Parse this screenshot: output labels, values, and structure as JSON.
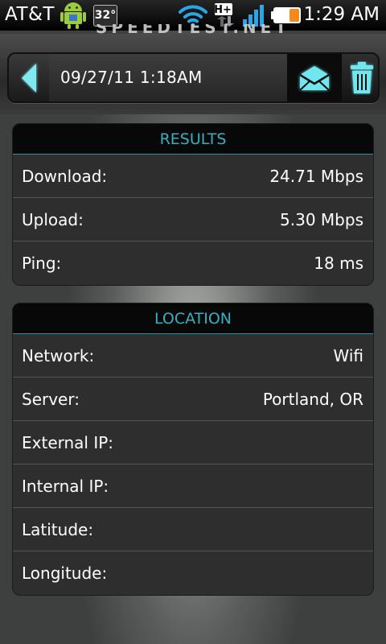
{
  "status_bar": {
    "carrier": "AT&T",
    "temperature": "32°",
    "network_type": "H+",
    "time": "1:29 AM",
    "icons": [
      "android-icon",
      "wifi-icon",
      "hplus-icon",
      "signal-icon",
      "battery-icon"
    ]
  },
  "app": {
    "title": "SPEEDTEST.NET"
  },
  "toolbar": {
    "date": "09/27/11 1:18AM",
    "back_icon": "back-arrow-icon",
    "email_icon": "email-icon",
    "delete_icon": "trash-icon"
  },
  "results": {
    "heading": "RESULTS",
    "rows": [
      {
        "label": "Download:",
        "value": "24.71 Mbps"
      },
      {
        "label": "Upload:",
        "value": "5.30 Mbps"
      },
      {
        "label": "Ping:",
        "value": "18 ms"
      }
    ]
  },
  "location": {
    "heading": "LOCATION",
    "rows": [
      {
        "label": "Network:",
        "value": "Wifi"
      },
      {
        "label": "Server:",
        "value": "Portland, OR"
      },
      {
        "label": "External IP:",
        "value": ""
      },
      {
        "label": "Internal IP:",
        "value": ""
      },
      {
        "label": "Latitude:",
        "value": ""
      },
      {
        "label": "Longitude:",
        "value": ""
      }
    ]
  },
  "colors": {
    "accent": "#36b0c1",
    "icon_glow": "#6fe6ee",
    "card_bg": "#2e2e2e"
  }
}
